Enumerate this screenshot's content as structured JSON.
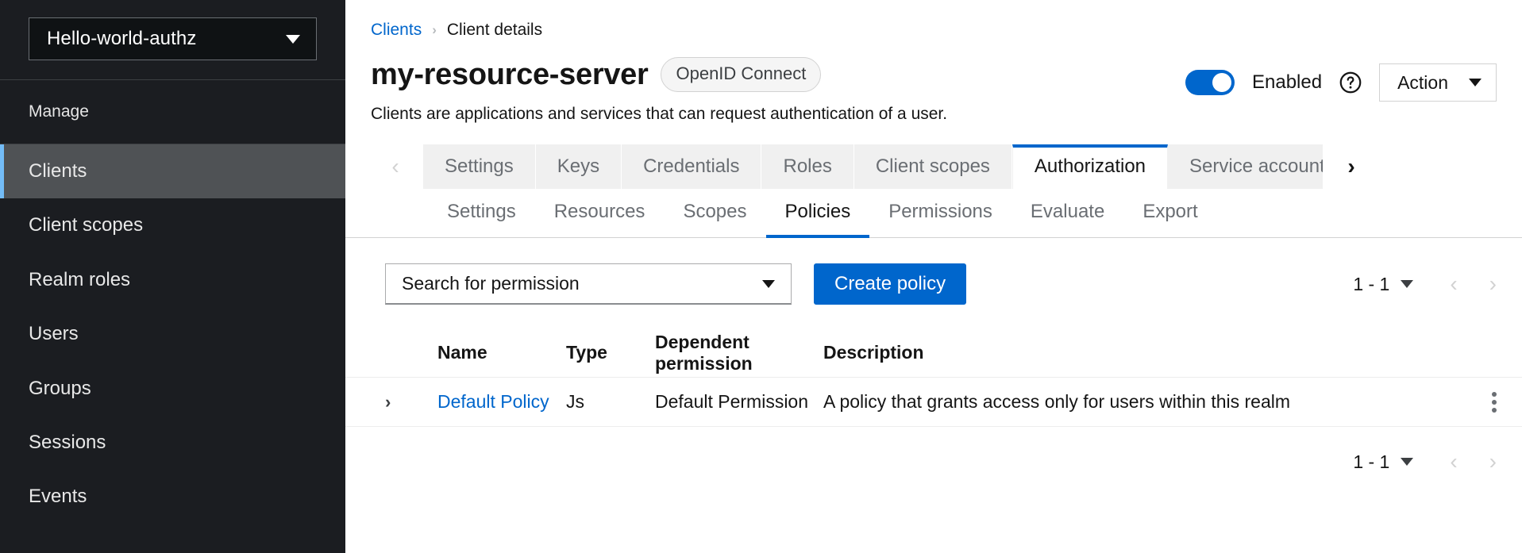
{
  "sidebar": {
    "realm_select": {
      "value": "Hello-world-authz",
      "icon": "caret-down-icon"
    },
    "section_title": "Manage",
    "items": [
      {
        "label": "Clients",
        "active": true
      },
      {
        "label": "Client scopes",
        "active": false
      },
      {
        "label": "Realm roles",
        "active": false
      },
      {
        "label": "Users",
        "active": false
      },
      {
        "label": "Groups",
        "active": false
      },
      {
        "label": "Sessions",
        "active": false
      },
      {
        "label": "Events",
        "active": false
      }
    ]
  },
  "breadcrumb": {
    "parent": "Clients",
    "separator": "›",
    "current": "Client details"
  },
  "header": {
    "title": "my-resource-server",
    "badge": "OpenID Connect",
    "subtitle": "Clients are applications and services that can request authentication of a user.",
    "toggle_label": "Enabled",
    "toggle_on": true,
    "help_icon": "help-circle-icon",
    "action_button": "Action",
    "action_caret": "caret-down-icon"
  },
  "tabs": {
    "scroll_left_icon": "chevron-left-icon",
    "scroll_right_icon": "chevron-right-icon",
    "items": [
      {
        "label": "Settings",
        "active": false
      },
      {
        "label": "Keys",
        "active": false
      },
      {
        "label": "Credentials",
        "active": false
      },
      {
        "label": "Roles",
        "active": false
      },
      {
        "label": "Client scopes",
        "active": false
      },
      {
        "label": "Authorization",
        "active": true
      },
      {
        "label": "Service accounts role",
        "active": false
      }
    ]
  },
  "subtabs": {
    "items": [
      {
        "label": "Settings",
        "active": false
      },
      {
        "label": "Resources",
        "active": false
      },
      {
        "label": "Scopes",
        "active": false
      },
      {
        "label": "Policies",
        "active": true
      },
      {
        "label": "Permissions",
        "active": false
      },
      {
        "label": "Evaluate",
        "active": false
      },
      {
        "label": "Export",
        "active": false
      }
    ]
  },
  "toolbar": {
    "search_value": "Search for permission",
    "search_caret": "caret-down-icon",
    "create_button": "Create policy"
  },
  "pagination": {
    "range": "1 - 1",
    "caret_icon": "caret-down-icon",
    "prev_icon": "chevron-left-icon",
    "next_icon": "chevron-right-icon"
  },
  "table": {
    "columns": [
      "Name",
      "Type",
      "Dependent permission",
      "Description"
    ],
    "rows": [
      {
        "expand_icon": "chevron-right-icon",
        "name": "Default Policy",
        "type": "Js",
        "dependent_permission": "Default Permission",
        "description": "A policy that grants access only for users within this realm",
        "kebab_icon": "kebab-menu-icon"
      }
    ]
  },
  "colors": {
    "accent_blue": "#0066cc",
    "sidebar_bg": "#1b1d21",
    "sidebar_active_bg": "#4f5255",
    "sidebar_active_border": "#73bcf7",
    "tab_inactive_bg": "#f0f0f0"
  }
}
